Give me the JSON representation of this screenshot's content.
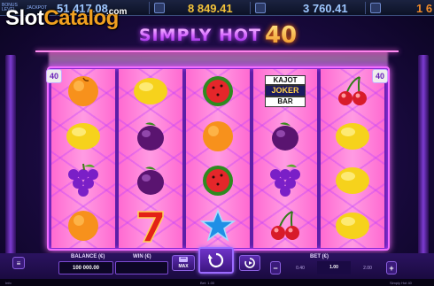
{
  "jackpots": {
    "bonus_label": "BONUS\nLEVEL",
    "mini_label": "JACKPOT",
    "values": [
      "51 417.08",
      "8 849.41",
      "3 760.41",
      "1 6"
    ]
  },
  "watermark": {
    "part1": "Slot",
    "part2": "Catalog",
    "dot": ".com"
  },
  "title": {
    "line1": "SIMPLY HOT",
    "line2": "40"
  },
  "lines_badge": "40",
  "reels": [
    [
      "orange",
      "lemon",
      "grapes",
      "orange"
    ],
    [
      "lemon",
      "plum",
      "plum",
      "seven"
    ],
    [
      "watermelon",
      "orange",
      "watermelon",
      "star"
    ],
    [
      "kajot-joker-bar",
      "plum",
      "grapes",
      "cherry"
    ],
    [
      "cherry",
      "lemon",
      "lemon",
      "lemon"
    ]
  ],
  "kajot": {
    "top": "KAJOT",
    "mid": "JOKER",
    "bot": "BAR"
  },
  "panel": {
    "balance_label": "BALANCE (€)",
    "balance_value": "100 000.00",
    "win_label": "WIN (€)",
    "win_value": "",
    "maxbet_label": "MAX",
    "bet_label": "BET (€)",
    "bet_options": [
      "0.40",
      "1.00",
      "2.00"
    ],
    "bet_selected_index": 1,
    "minus": "−",
    "plus": "+"
  },
  "status": {
    "left": "Info",
    "mid": "Bet: 1.00",
    "right": "Simply Hot 40"
  },
  "icons": {
    "spin": "spin-icon",
    "autoplay": "autoplay-icon",
    "maxbet": "max-bet-icon",
    "menu": "menu-icon"
  },
  "colors": {
    "frame": "#f26bff",
    "reel": "#ff8fdd",
    "gold": "#f4c33a"
  }
}
